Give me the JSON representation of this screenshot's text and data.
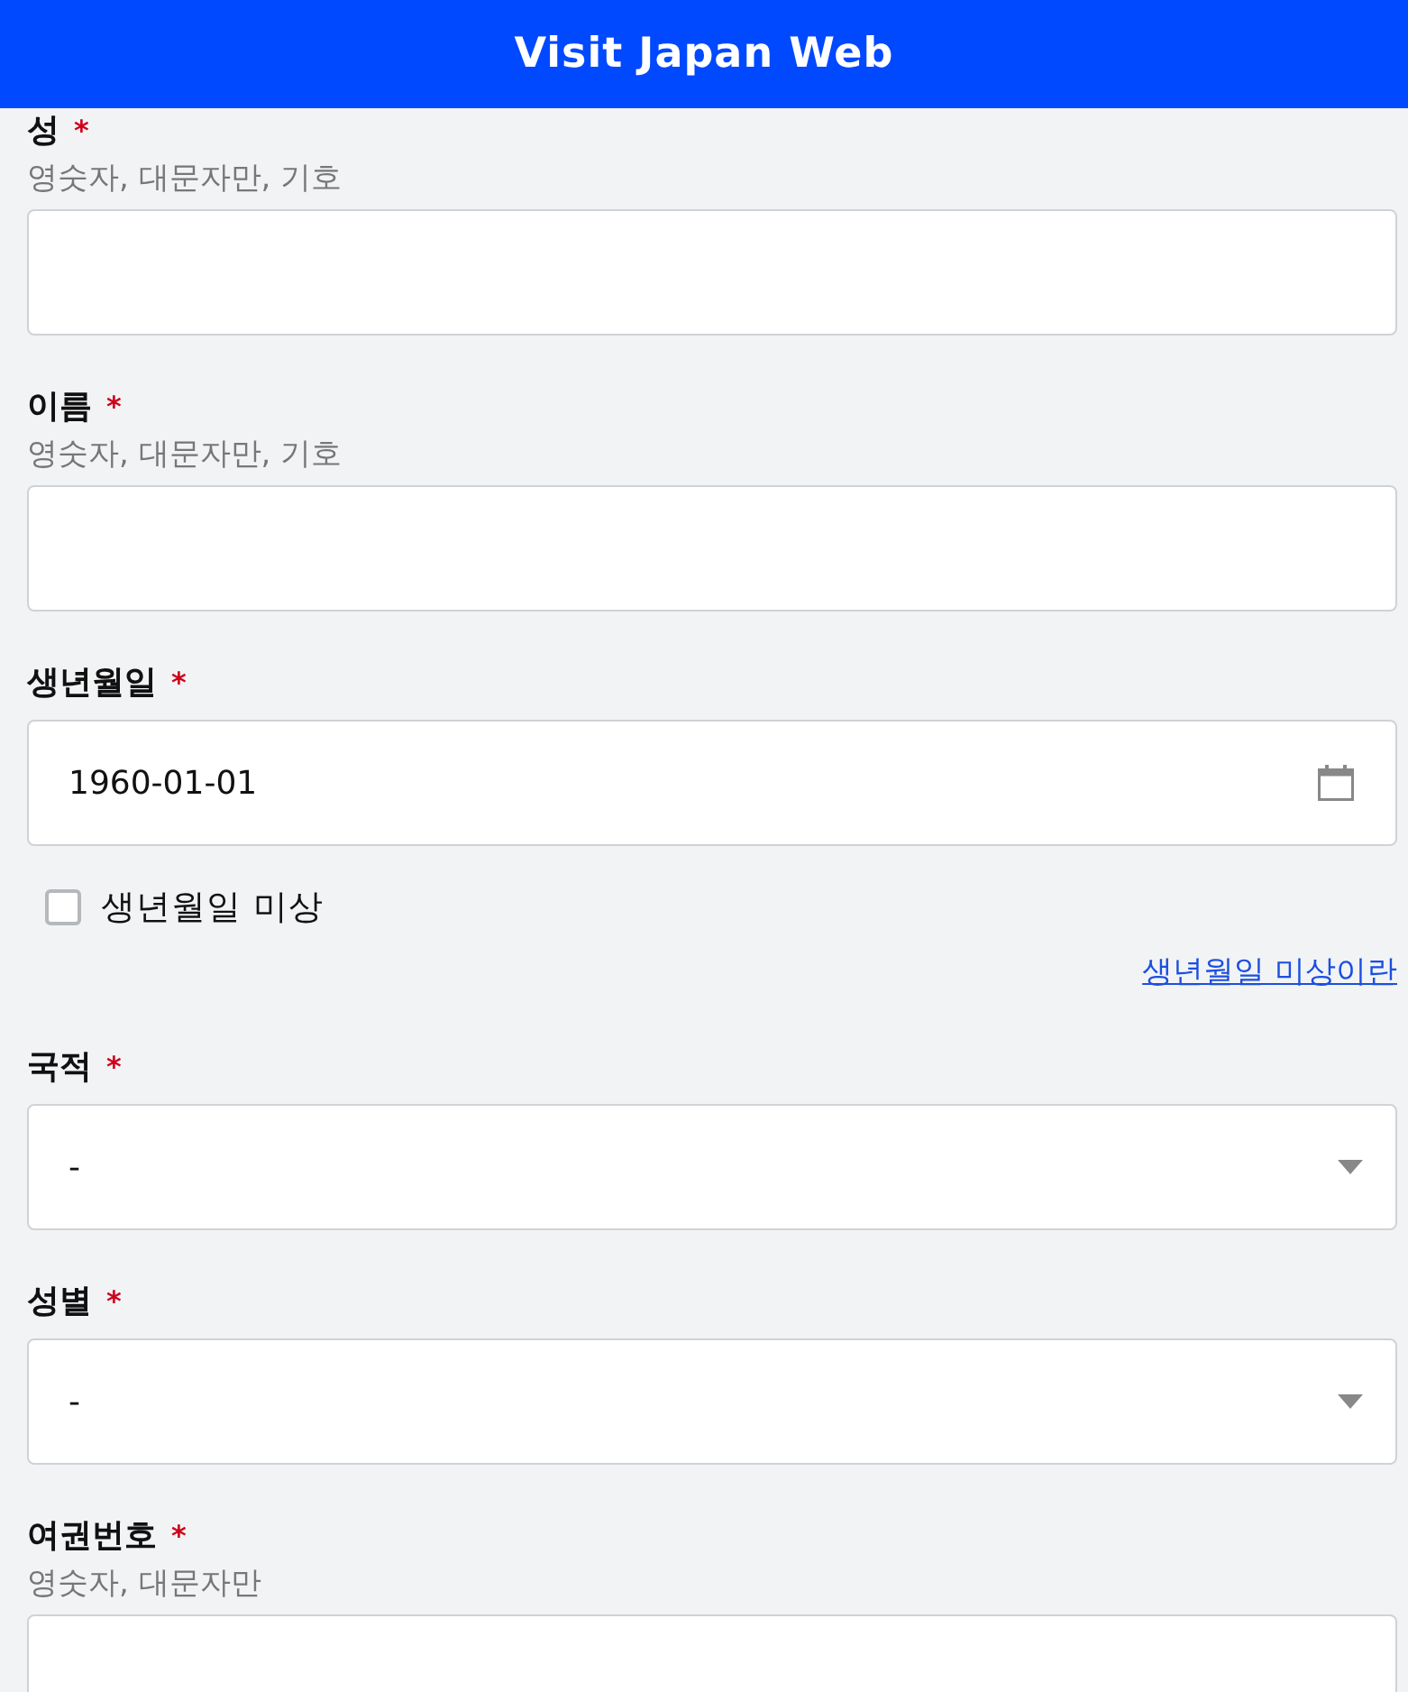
{
  "header": {
    "title": "Visit Japan Web"
  },
  "fields": [
    {
      "kind": "text",
      "label": "성",
      "required_mark": "*",
      "hint": "영숫자, 대문자만, 기호"
    },
    {
      "kind": "text",
      "label": "이름",
      "required_mark": "*",
      "hint": "영숫자, 대문자만, 기호"
    },
    {
      "kind": "date",
      "label": "생년월일",
      "required_mark": "*",
      "value": "1960-01-01"
    },
    {
      "kind": "checkbox",
      "label": "생년월일 미상",
      "checked": false
    },
    {
      "kind": "link",
      "label": "생년월일 미상이란"
    },
    {
      "kind": "select",
      "label": "국적",
      "required_mark": "*",
      "value": "-"
    },
    {
      "kind": "select",
      "label": "성별",
      "required_mark": "*",
      "value": "-"
    },
    {
      "kind": "text",
      "label": "여권번호",
      "required_mark": "*",
      "hint": "영숫자, 대문자만"
    }
  ]
}
